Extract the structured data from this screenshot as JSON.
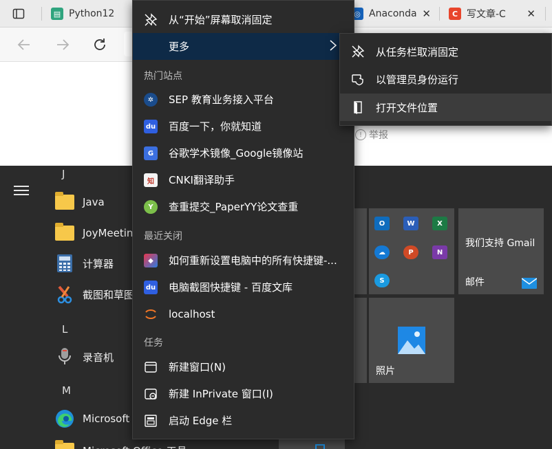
{
  "browser": {
    "tabs": [
      {
        "label": "Python12",
        "icon": "python-tab-icon",
        "color": "#2fa47e"
      },
      {
        "label": "Anaconda",
        "icon": "anaconda-tab-icon",
        "color": "#1565c0"
      },
      {
        "label": "写文章-C",
        "icon": "csdn-tab-icon",
        "color": "#e8452c"
      }
    ],
    "report_label": "举报"
  },
  "start": {
    "letters": {
      "j": "J",
      "l": "L",
      "m": "M"
    },
    "apps": [
      {
        "label": "Java",
        "icon": "folder-icon"
      },
      {
        "label": "JoyMeeting",
        "icon": "folder-icon"
      },
      {
        "label": "计算器",
        "icon": "calculator-icon"
      },
      {
        "label": "截图和草图",
        "icon": "snip-sketch-icon"
      },
      {
        "label": "录音机",
        "icon": "voice-recorder-icon"
      },
      {
        "label": "Microsoft Edge",
        "icon": "edge-icon"
      },
      {
        "label": "Microsoft Office 工具",
        "icon": "folder-icon"
      }
    ],
    "tiles": {
      "gmail_text": "我们支持 Gmail",
      "mail_label": "邮件",
      "photos_label": "照片",
      "office_apps": [
        "Outlook",
        "Word",
        "Excel",
        "OneDrive",
        "PowerPoint",
        "OneNote",
        "Skype"
      ]
    }
  },
  "context_menu": {
    "unpin_start": "从“开始”屏幕取消固定",
    "more": "更多",
    "sections": {
      "top_sites": "热门站点",
      "recently_closed": "最近关闭",
      "tasks": "任务"
    },
    "top_sites": [
      {
        "label": "SEP 教育业务接入平台",
        "icon": "sep-icon"
      },
      {
        "label": "百度一下，你就知道",
        "icon": "baidu-icon"
      },
      {
        "label": "谷歌学术镜像_Google镜像站",
        "icon": "scholar-icon"
      },
      {
        "label": "CNKI翻译助手",
        "icon": "cnki-icon"
      },
      {
        "label": "查重提交_PaperYY论文查重",
        "icon": "paperyy-icon"
      }
    ],
    "recently_closed": [
      {
        "label": "如何重新设置电脑中的所有快捷键-...",
        "icon": "page-icon"
      },
      {
        "label": "电脑截图快捷键 - 百度文库",
        "icon": "baidu-wenku-icon"
      },
      {
        "label": "localhost",
        "icon": "jupyter-icon"
      }
    ],
    "tasks": [
      {
        "label": "新建窗口(N)",
        "icon": "new-window-icon"
      },
      {
        "label": "新建 InPrivate 窗口(I)",
        "icon": "inprivate-icon"
      },
      {
        "label": "启动 Edge 栏",
        "icon": "edge-bar-icon"
      }
    ]
  },
  "submenu": {
    "items": [
      {
        "label": "从任务栏取消固定",
        "icon": "unpin-icon"
      },
      {
        "label": "以管理员身份运行",
        "icon": "shield-icon"
      },
      {
        "label": "打开文件位置",
        "icon": "open-file-location-icon"
      }
    ]
  }
}
